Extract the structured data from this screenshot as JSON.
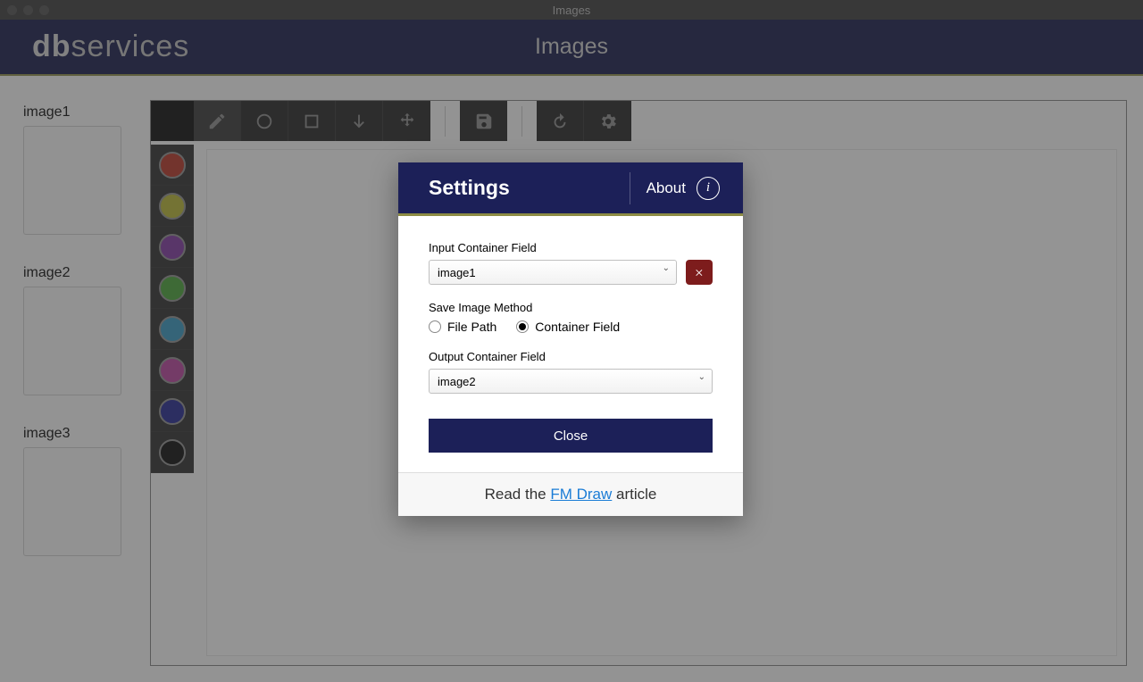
{
  "window": {
    "title": "Images"
  },
  "banner": {
    "logo_bold": "db",
    "logo_light": "services",
    "title": "Images"
  },
  "sidebar": {
    "items": [
      "image1",
      "image2",
      "image3"
    ]
  },
  "palette": {
    "current": "#000000",
    "colors": [
      "#b52a1b",
      "#b8b72c",
      "#7c2fa0",
      "#40a32f",
      "#2d96c2",
      "#b93a9c",
      "#1a1e8f",
      "#000000"
    ]
  },
  "toolbar_icons": [
    "pencil",
    "circle",
    "square",
    "arrow-down",
    "move",
    "save",
    "rotate",
    "gear"
  ],
  "modal": {
    "title": "Settings",
    "about": "About",
    "input_label": "Input Container Field",
    "input_value": "image1",
    "method_label": "Save Image Method",
    "method_options": [
      "File Path",
      "Container Field"
    ],
    "method_selected": "Container Field",
    "output_label": "Output Container Field",
    "output_value": "image2",
    "close_label": "Close",
    "footer_prefix": "Read the ",
    "footer_link": "FM Draw",
    "footer_suffix": " article"
  }
}
